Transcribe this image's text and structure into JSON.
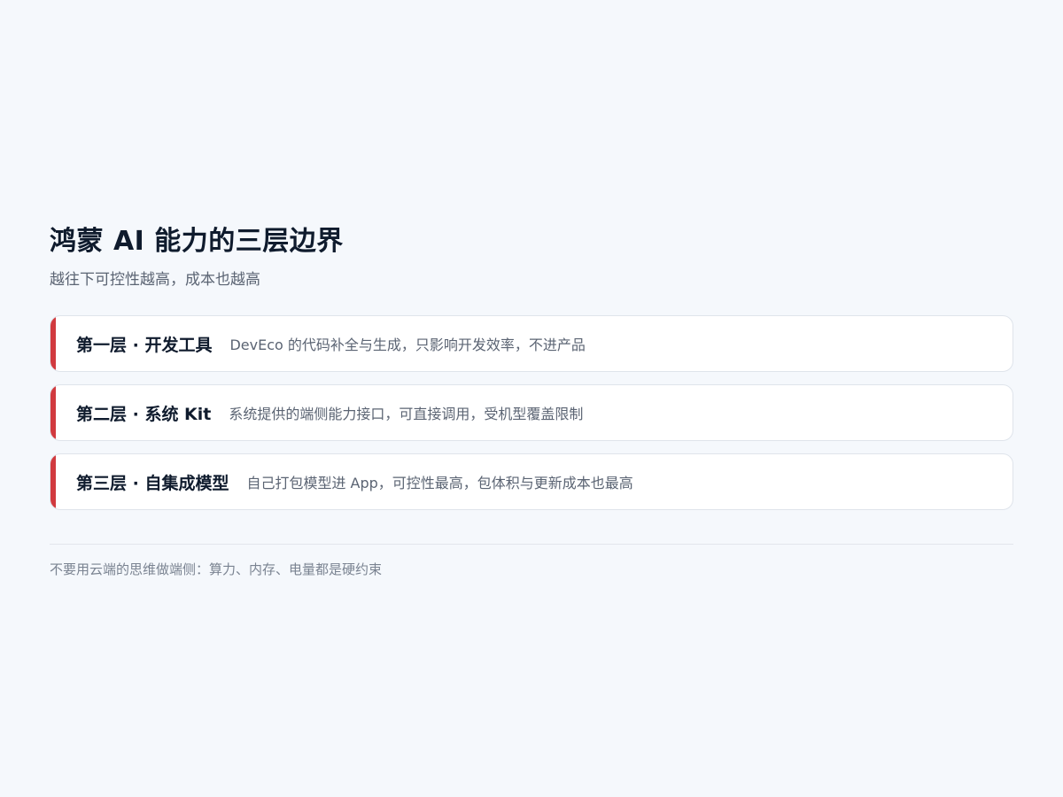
{
  "header": {
    "title": "鸿蒙 AI 能力的三层边界",
    "subtitle": "越往下可控性越高，成本也越高"
  },
  "layers": [
    {
      "name": "第一层 · 开发工具",
      "description": "DevEco 的代码补全与生成，只影响开发效率，不进产品"
    },
    {
      "name": "第二层 · 系统 Kit",
      "description": "系统提供的端侧能力接口，可直接调用，受机型覆盖限制"
    },
    {
      "name": "第三层 · 自集成模型",
      "description": "自己打包模型进 App，可控性最高，包体积与更新成本也最高"
    }
  ],
  "footer": {
    "note": "不要用云端的思维做端侧：算力、内存、电量都是硬约束"
  },
  "colors": {
    "background": "#f5f8fc",
    "accent": "#d13a3f",
    "title": "#0f1b2d",
    "muted": "#5b6473"
  }
}
